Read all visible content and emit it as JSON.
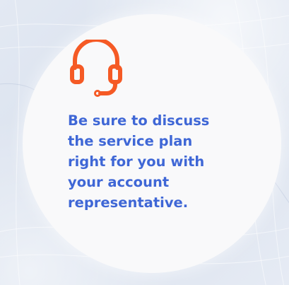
{
  "icon": "headset-icon",
  "colors": {
    "accent_icon": "#f55a25",
    "text_blue": "#3f67d6",
    "circle_bg": "#f9f9fa",
    "backdrop": "#dfe6f1"
  },
  "message": {
    "lines": [
      "Be sure to discuss",
      "the service plan",
      "right for you with",
      "your account",
      "representative."
    ]
  }
}
